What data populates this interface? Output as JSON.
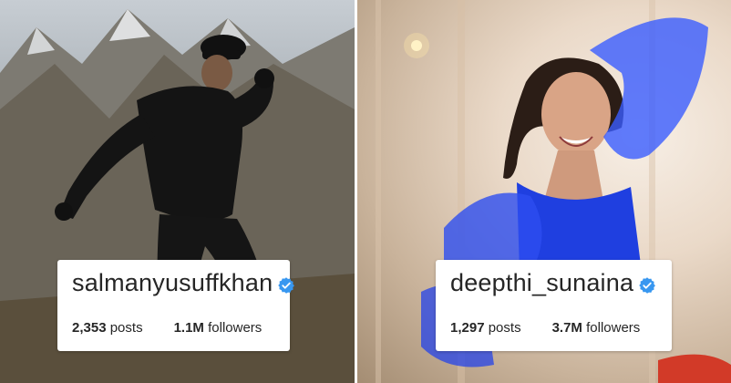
{
  "left_profile": {
    "username": "salmanyusuffkhan",
    "posts_count": "2,353",
    "posts_label": "posts",
    "followers_count": "1.1M",
    "followers_label": "followers"
  },
  "right_profile": {
    "username": "deepthi_sunaina",
    "posts_count": "1,297",
    "posts_label": "posts",
    "followers_count": "3.7M",
    "followers_label": "followers"
  },
  "icons": {
    "verified": "verified-badge-icon"
  },
  "colors": {
    "verified_blue": "#3897f0",
    "text": "#262626",
    "card_bg": "#ffffff",
    "dress_blue": "#1f3fe0"
  }
}
